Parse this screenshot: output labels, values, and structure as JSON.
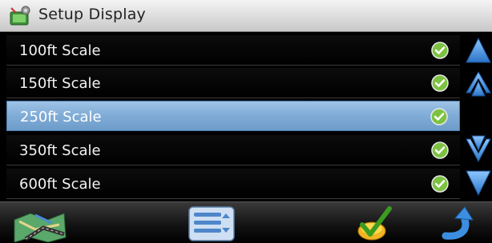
{
  "header": {
    "title": "Setup Display",
    "icon": "settings-app-icon"
  },
  "list": {
    "items": [
      {
        "label": "100ft Scale",
        "checked": true
      },
      {
        "label": "150ft Scale",
        "checked": true
      },
      {
        "label": "250ft Scale",
        "checked": true,
        "selected": true
      },
      {
        "label": "350ft Scale",
        "checked": true
      },
      {
        "label": "600ft Scale",
        "checked": true
      }
    ]
  },
  "scrollbar": {
    "buttons": [
      "page-up-icon",
      "line-up-icon",
      "line-down-icon",
      "page-down-icon"
    ]
  },
  "toolbar": {
    "buttons": [
      "map-icon",
      "menu-list-icon",
      "confirm-check-icon",
      "back-arrow-icon"
    ]
  },
  "colors": {
    "selected_row": "#7fabd6",
    "check_green": "#7cc240",
    "arrow_blue": "#3c8fe0"
  }
}
